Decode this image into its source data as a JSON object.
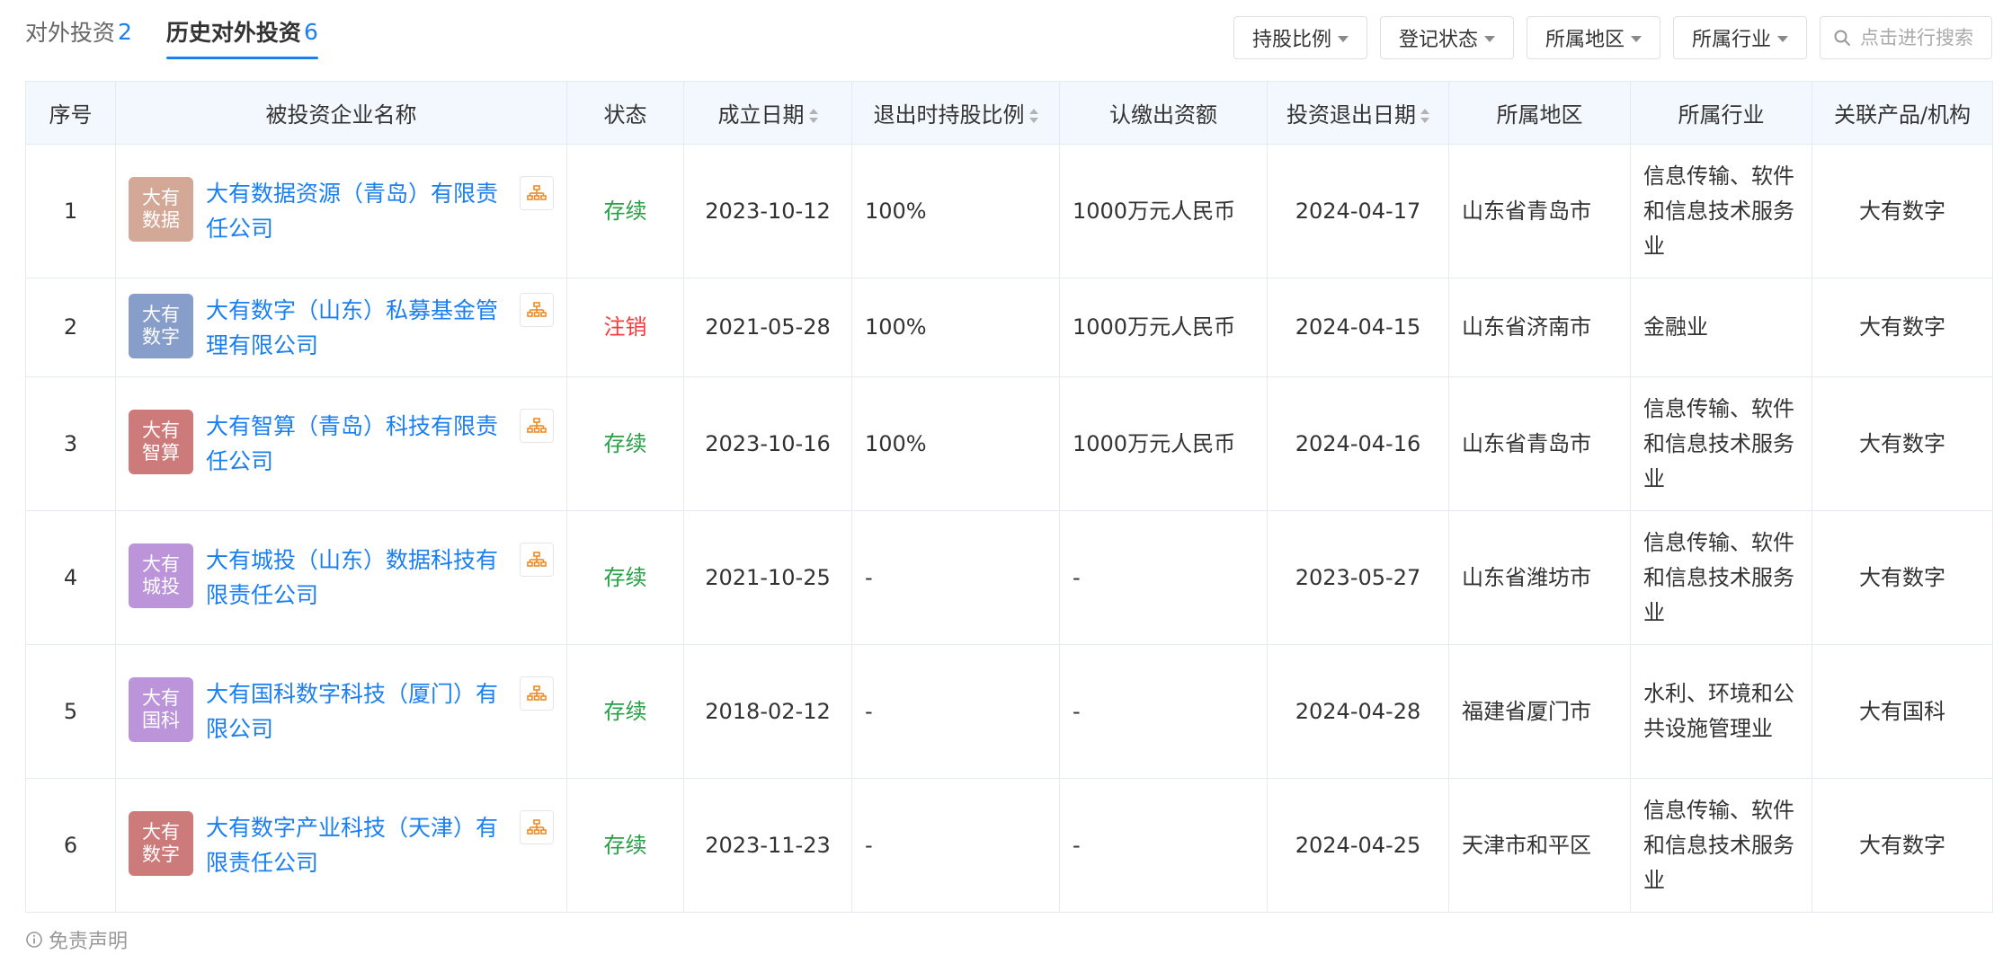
{
  "tabs": [
    {
      "label": "对外投资",
      "count": "2"
    },
    {
      "label": "历史对外投资",
      "count": "6"
    }
  ],
  "filters": {
    "items": [
      "持股比例",
      "登记状态",
      "所属地区",
      "所属行业"
    ],
    "search_placeholder": "点击进行搜索"
  },
  "table": {
    "headers": [
      "序号",
      "被投资企业名称",
      "状态",
      "成立日期",
      "退出时持股比例",
      "认缴出资额",
      "投资退出日期",
      "所属地区",
      "所属行业",
      "关联产品/机构"
    ],
    "rows": [
      {
        "no": "1",
        "logo": "大有数据",
        "logo_color": "#d4a896",
        "name": "大有数据资源（青岛）有限责任公司",
        "status": "存续",
        "status_color": "#27a046",
        "founded": "2023-10-12",
        "ratio": "100%",
        "capital": "1000万元人民币",
        "exit_date": "2024-04-17",
        "region": "山东省青岛市",
        "industry": "信息传输、软件和信息技术服务业",
        "product": "大有数字"
      },
      {
        "no": "2",
        "logo": "大有数字",
        "logo_color": "#879ecb",
        "name": "大有数字（山东）私募基金管理有限公司",
        "status": "注销",
        "status_color": "#f23d3d",
        "founded": "2021-05-28",
        "ratio": "100%",
        "capital": "1000万元人民币",
        "exit_date": "2024-04-15",
        "region": "山东省济南市",
        "industry": "金融业",
        "product": "大有数字"
      },
      {
        "no": "3",
        "logo": "大有智算",
        "logo_color": "#cc7a7a",
        "name": "大有智算（青岛）科技有限责任公司",
        "status": "存续",
        "status_color": "#27a046",
        "founded": "2023-10-16",
        "ratio": "100%",
        "capital": "1000万元人民币",
        "exit_date": "2024-04-16",
        "region": "山东省青岛市",
        "industry": "信息传输、软件和信息技术服务业",
        "product": "大有数字"
      },
      {
        "no": "4",
        "logo": "大有城投",
        "logo_color": "#bb94da",
        "name": "大有城投（山东）数据科技有限责任公司",
        "status": "存续",
        "status_color": "#27a046",
        "founded": "2021-10-25",
        "ratio": "-",
        "capital": "-",
        "exit_date": "2023-05-27",
        "region": "山东省潍坊市",
        "industry": "信息传输、软件和信息技术服务业",
        "product": "大有数字"
      },
      {
        "no": "5",
        "logo": "大有国科",
        "logo_color": "#bb94da",
        "name": "大有国科数字科技（厦门）有限公司",
        "status": "存续",
        "status_color": "#27a046",
        "founded": "2018-02-12",
        "ratio": "-",
        "capital": "-",
        "exit_date": "2024-04-28",
        "region": "福建省厦门市",
        "industry": "水利、环境和公共设施管理业",
        "product": "大有国科"
      },
      {
        "no": "6",
        "logo": "大有数字",
        "logo_color": "#cc7a7a",
        "name": "大有数字产业科技（天津）有限责任公司",
        "status": "存续",
        "status_color": "#27a046",
        "founded": "2023-11-23",
        "ratio": "-",
        "capital": "-",
        "exit_date": "2024-04-25",
        "region": "天津市和平区",
        "industry": "信息传输、软件和信息技术服务业",
        "product": "大有数字"
      }
    ]
  },
  "footer": {
    "disclaimer": "免责声明"
  },
  "colors": {
    "accent": "#1a7ff0",
    "header_bg": "#f2f8fe",
    "border": "#e4eaf1",
    "chart_icon": "#f08a24"
  }
}
